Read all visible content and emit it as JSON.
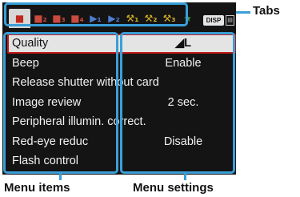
{
  "tabs": [
    {
      "glyph": "■",
      "kind": "shooting",
      "active": true
    },
    {
      "glyph": "■₂",
      "kind": "shooting"
    },
    {
      "glyph": "■₃",
      "kind": "shooting"
    },
    {
      "glyph": "■₄",
      "kind": "shooting"
    },
    {
      "glyph": "▶₁",
      "kind": "play"
    },
    {
      "glyph": "▶₂",
      "kind": "play"
    },
    {
      "glyph": "⚒₁",
      "kind": "setup"
    },
    {
      "glyph": "⚒₂",
      "kind": "setup"
    },
    {
      "glyph": "⚒₃",
      "kind": "setup"
    },
    {
      "glyph": "★",
      "kind": "mymenu"
    }
  ],
  "disp_label": "DISP",
  "menu": [
    {
      "label": "Quality",
      "value": "◢L",
      "selected": true
    },
    {
      "label": "Beep",
      "value": "Enable"
    },
    {
      "label": "Release shutter without card",
      "value": ""
    },
    {
      "label": "Image review",
      "value": "2 sec."
    },
    {
      "label": "Peripheral illumin. correct.",
      "value": ""
    },
    {
      "label": "Red-eye reduc",
      "value": "Disable"
    },
    {
      "label": "Flash control",
      "value": ""
    }
  ],
  "captions": {
    "tabs": "Tabs",
    "menu_items": "Menu items",
    "menu_settings": "Menu settings"
  },
  "colors": {
    "callout": "#3a9fd8",
    "selection_border": "#c01a1a",
    "screen_bg": "#141414"
  }
}
